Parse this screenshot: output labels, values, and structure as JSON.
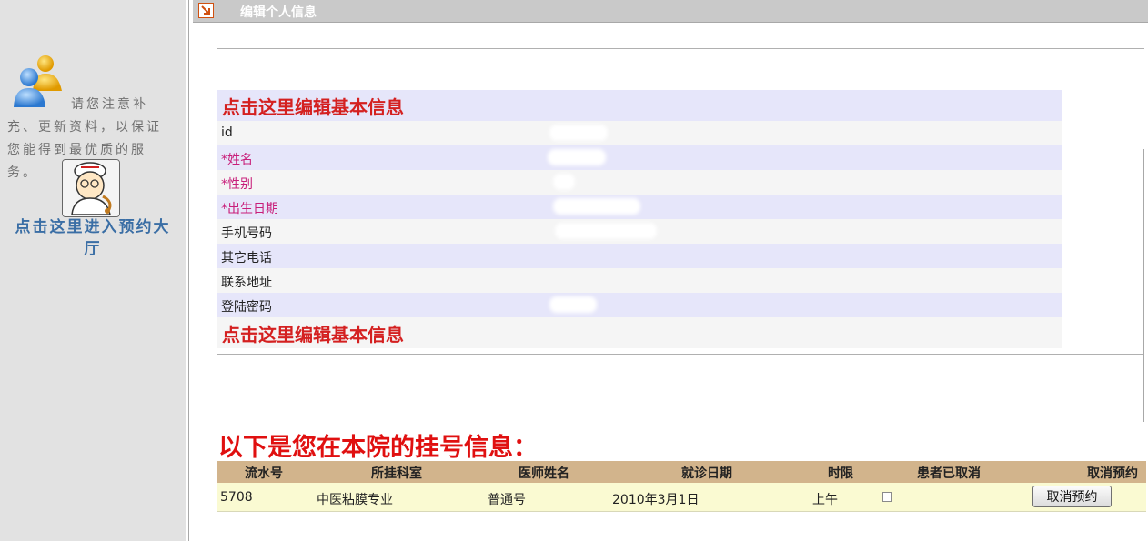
{
  "sidebar": {
    "notice": "请您注意补充、更新资料，以保证您能得到最优质的服务。",
    "enter_link": "点击这里进入预约大厅",
    "icons": [
      "users-icon",
      "doctor-icon"
    ]
  },
  "header": {
    "title": "编辑个人信息",
    "icon": "arrow-icon"
  },
  "profile": {
    "edit_link_top": "点击这里编辑基本信息",
    "edit_link_bottom": "点击这里编辑基本信息",
    "fields": [
      {
        "label": "id"
      },
      {
        "label": "*姓名"
      },
      {
        "label": "*性别"
      },
      {
        "label": "*出生日期"
      },
      {
        "label": "手机号码"
      },
      {
        "label": "其它电话"
      },
      {
        "label": "联系地址"
      },
      {
        "label": "登陆密码"
      }
    ]
  },
  "registrations": {
    "heading": "以下是您在本院的挂号信息：",
    "columns": [
      "流水号",
      "所挂科室",
      "医师姓名",
      "就诊日期",
      "时限",
      "患者已取消",
      "取消预约"
    ],
    "rows": [
      {
        "serial": "5708",
        "department": "中医粘膜专业",
        "doctor": "普通号",
        "date": "2010年3月1日",
        "period": "上午",
        "cancelled": false,
        "cancel_button": "取消预约"
      }
    ]
  },
  "colors": {
    "sidebar_bg": "#e2e2e2",
    "link_blue": "#3a6ea5",
    "edit_red": "#d42020",
    "required_magenta": "#c81e7a",
    "row_lavender": "#e6e6fa",
    "row_grey": "#f5f5f5",
    "table_header_tan": "#d2b48c",
    "table_row_yellow": "#fafad2"
  }
}
